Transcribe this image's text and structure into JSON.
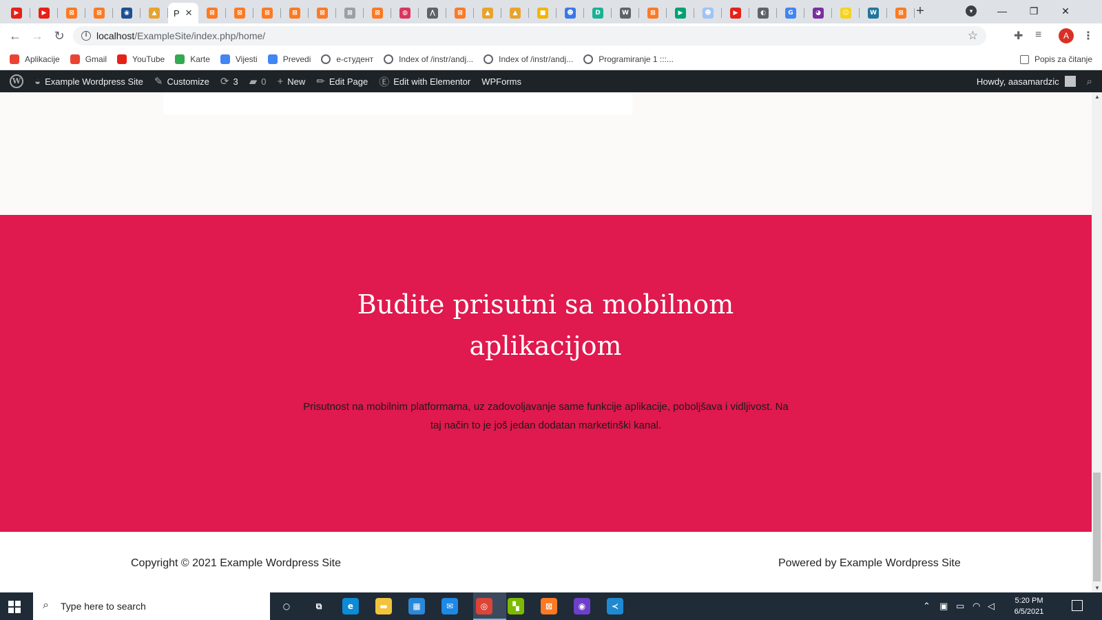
{
  "browser": {
    "tabs": [
      {
        "icon": "youtube-icon",
        "color": "#e62117",
        "glyph": "▶"
      },
      {
        "icon": "youtube-icon",
        "color": "#e62117",
        "glyph": "▶"
      },
      {
        "icon": "xampp-icon",
        "color": "#fb7a24",
        "glyph": "⊠"
      },
      {
        "icon": "xampp-icon",
        "color": "#fb7a24",
        "glyph": "⊠"
      },
      {
        "icon": "blue-hex-icon",
        "color": "#1d4f91",
        "glyph": "◉"
      },
      {
        "icon": "phpmyadmin-icon",
        "color": "#e8a32e",
        "glyph": "▲"
      },
      {
        "icon": "xampp-icon",
        "color": "#fb7a24",
        "glyph": "⊠"
      },
      {
        "icon": "xampp-icon",
        "color": "#fb7a24",
        "glyph": "⊠"
      },
      {
        "icon": "xampp-icon",
        "color": "#fb7a24",
        "glyph": "⊠"
      },
      {
        "icon": "xampp-icon",
        "color": "#fb7a24",
        "glyph": "⊠"
      },
      {
        "icon": "xampp-icon",
        "color": "#fb7a24",
        "glyph": "⊠"
      },
      {
        "icon": "xampp-grey-icon",
        "color": "#9aa0a6",
        "glyph": "⊠"
      },
      {
        "icon": "xampp-icon",
        "color": "#fb7a24",
        "glyph": "⊠"
      },
      {
        "icon": "dribbble-icon",
        "color": "#d9365e",
        "glyph": "◍"
      },
      {
        "icon": "mountain-icon",
        "color": "#5f6368",
        "glyph": "⋀"
      },
      {
        "icon": "xampp-icon",
        "color": "#fb7a24",
        "glyph": "⊠"
      },
      {
        "icon": "phpmyadmin-icon",
        "color": "#e8a32e",
        "glyph": "▲"
      },
      {
        "icon": "phpmyadmin-icon",
        "color": "#e8a32e",
        "glyph": "▲"
      },
      {
        "icon": "yellow-board-icon",
        "color": "#f2b600",
        "glyph": "■"
      },
      {
        "icon": "people-icon",
        "color": "#3b78e7",
        "glyph": "☻"
      },
      {
        "icon": "d-icon",
        "color": "#19b394",
        "glyph": "D"
      },
      {
        "icon": "wikipedia-icon",
        "color": "#5f6368",
        "glyph": "W"
      },
      {
        "icon": "xampp-icon",
        "color": "#fb7a24",
        "glyph": "⊠"
      },
      {
        "icon": "play-store-icon",
        "color": "#00a173",
        "glyph": "▶"
      },
      {
        "icon": "people-icon",
        "color": "#9fc4f5",
        "glyph": "☻"
      },
      {
        "icon": "youtube-icon",
        "color": "#e62117",
        "glyph": "▶"
      },
      {
        "icon": "globe-icon",
        "color": "#5f6368",
        "glyph": "◐"
      },
      {
        "icon": "google-icon",
        "color": "#4285f4",
        "glyph": "G"
      },
      {
        "icon": "purple-icon",
        "color": "#7b2ea0",
        "glyph": "◕"
      },
      {
        "icon": "snapchat-icon",
        "color": "#f4d31f",
        "glyph": "☺"
      },
      {
        "icon": "wordpress-icon",
        "color": "#21759b",
        "glyph": "W"
      },
      {
        "icon": "xampp-icon",
        "color": "#fb7a24",
        "glyph": "⊠"
      }
    ],
    "active_tab_letter": "P",
    "active_tab_index": 6,
    "url_host": "localhost",
    "url_path": "/ExampleSite/index.php/home/",
    "bookmarks": [
      {
        "label": "Aplikacije",
        "icon": "apps-grid-icon",
        "color": "#ea4335"
      },
      {
        "label": "Gmail",
        "icon": "gmail-icon",
        "color": "#ea4335"
      },
      {
        "label": "YouTube",
        "icon": "youtube-icon",
        "color": "#e62117"
      },
      {
        "label": "Karte",
        "icon": "maps-icon",
        "color": "#34a853"
      },
      {
        "label": "Vijesti",
        "icon": "news-icon",
        "color": "#4285f4"
      },
      {
        "label": "Prevedi",
        "icon": "translate-icon",
        "color": "#4285f4"
      },
      {
        "label": "e-студент",
        "icon": "globe-icon",
        "color": ""
      },
      {
        "label": "Index of /instr/andj...",
        "icon": "globe-icon",
        "color": ""
      },
      {
        "label": "Index of /instr/andj...",
        "icon": "globe-icon",
        "color": ""
      },
      {
        "label": "Programiranje 1 :::...",
        "icon": "globe-icon",
        "color": ""
      }
    ],
    "reading_list": "Popis za čitanje",
    "profile_initial": "A"
  },
  "adminbar": {
    "site_name": "Example Wordpress Site",
    "customize": "Customize",
    "updates_count": "3",
    "comments_count": "0",
    "new": "New",
    "edit_page": "Edit Page",
    "edit_elementor": "Edit with Elementor",
    "wpforms": "WPForms",
    "howdy": "Howdy, aasamardzic"
  },
  "page": {
    "hero_title": "Budite prisutni sa mobilnom aplikacijom",
    "hero_text": "Prisutnost na mobilnim platformama, uz zadovoljavanje same funkcije aplikacije, poboljšava i vidljivost. Na taj način to je još jedan dodatan marketinški kanal.",
    "copyright": "Copyright © 2021 Example Wordpress Site",
    "powered_by": "Powered by Example Wordpress Site",
    "hero_color": "#e0194e"
  },
  "taskbar": {
    "search_placeholder": "Type here to search",
    "apps": [
      {
        "name": "cortana-icon",
        "color": "transparent",
        "glyph": "○"
      },
      {
        "name": "task-view-icon",
        "color": "transparent",
        "glyph": "⧉"
      },
      {
        "name": "edge-icon",
        "color": "#0c8bd6",
        "glyph": "e"
      },
      {
        "name": "file-explorer-icon",
        "color": "#f3c33c",
        "glyph": "▬"
      },
      {
        "name": "store-icon",
        "color": "#2b88d8",
        "glyph": "▦"
      },
      {
        "name": "mail-icon",
        "color": "#1e88e5",
        "glyph": "✉"
      },
      {
        "name": "chrome-icon",
        "color": "#db4437",
        "glyph": "◎"
      },
      {
        "name": "tiles-app-icon",
        "color": "#7cbb00",
        "glyph": "▚"
      },
      {
        "name": "xampp-icon",
        "color": "#fb7a24",
        "glyph": "⊠"
      },
      {
        "name": "github-icon",
        "color": "#6e40c9",
        "glyph": "◉"
      },
      {
        "name": "vscode-icon",
        "color": "#1f8ad2",
        "glyph": "≺"
      }
    ],
    "time": "5:20 PM",
    "date": "6/5/2021"
  }
}
